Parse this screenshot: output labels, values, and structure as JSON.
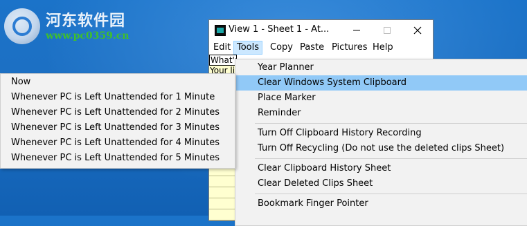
{
  "watermark": {
    "title": "河东软件园",
    "url": "www.pc0359.cn"
  },
  "window": {
    "title": "View 1  -  Sheet 1  -  At...",
    "minimize_icon": "minimize-icon",
    "maximize_icon": "maximize-icon",
    "close_icon": "close-icon"
  },
  "menubar": {
    "items": [
      "Edit",
      "Tools",
      "Copy",
      "Paste",
      "Pictures",
      "Help"
    ],
    "active": "Tools"
  },
  "sheet": {
    "rows": [
      "What's",
      "Your li"
    ]
  },
  "tools_menu": {
    "items": [
      "Year Planner",
      "Clear Windows System Clipboard",
      "Place Marker",
      "Reminder",
      "Turn Off Clipboard History Recording",
      "Turn Off Recycling (Do not use the deleted clips Sheet)",
      "Clear Clipboard History Sheet",
      "Clear Deleted Clips Sheet",
      "Bookmark Finger Pointer"
    ],
    "highlighted": "Clear Windows System Clipboard"
  },
  "submenu": {
    "items": [
      "Now",
      "Whenever PC is Left Unattended for 1 Minute",
      "Whenever PC is Left Unattended for 2 Minutes",
      "Whenever PC is Left Unattended for 3 Minutes",
      "Whenever PC is Left Unattended for 4 Minutes",
      "Whenever PC is Left Unattended for 5 Minutes"
    ]
  },
  "colors": {
    "desktop": "#1b73c9",
    "highlight": "#91c9f7",
    "sheet": "#ffffd0"
  }
}
